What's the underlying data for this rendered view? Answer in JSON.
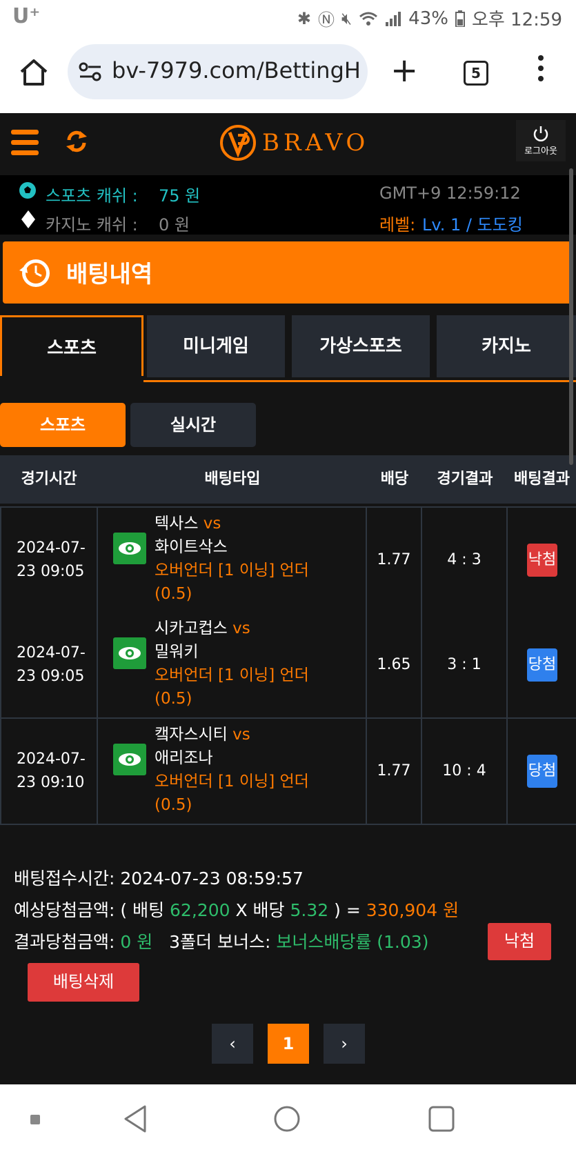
{
  "status_bar": {
    "carrier": "U⁺",
    "battery": "43%",
    "time": "오후 12:59"
  },
  "browser": {
    "url": "bv-7979.com/BettingH",
    "tab_count": "5"
  },
  "site": {
    "logo_text": "BRAVO",
    "logout_label": "로그아웃"
  },
  "account": {
    "sports_cash_label": "스포츠 캐쉬 :",
    "sports_cash_value": "75 원",
    "casino_cash_label": "카지노 캐쉬 :",
    "casino_cash_value": "0 원",
    "clock": "GMT+9 12:59:12",
    "level_label": "레벨:",
    "level_value": "Lv. 1 / 도도킹"
  },
  "page_title": "배팅내역",
  "main_tabs": [
    "스포츠",
    "미니게임",
    "가상스포츠",
    "카지노"
  ],
  "sub_tabs": [
    "스포츠",
    "실시간"
  ],
  "table": {
    "headers": [
      "경기시간",
      "배팅타입",
      "배당",
      "경기결과",
      "배팅결과"
    ],
    "rows": [
      {
        "date": "2024-07-",
        "time": "23 09:05",
        "home": "텍사스",
        "vs": "vs",
        "away": "화이트삭스",
        "bet1": "오버언더 [1 이닝] 언더",
        "bet2": "(0.5)",
        "odds": "1.77",
        "score": "4 : 3",
        "result": "낙첨"
      },
      {
        "date": "2024-07-",
        "time": "23 09:05",
        "home": "시카고컵스",
        "vs": "vs",
        "away": "밀워키",
        "bet1": "오버언더 [1 이닝] 언더",
        "bet2": "(0.5)",
        "odds": "1.65",
        "score": "3 : 1",
        "result": "당첨"
      },
      {
        "date": "2024-07-",
        "time": "23 09:10",
        "home": "캨자스시티",
        "vs": "vs",
        "away": "애리조나",
        "bet1": "오버언더 [1 이닝] 언더",
        "bet2": "(0.5)",
        "odds": "1.77",
        "score": "10 : 4",
        "result": "당첨"
      }
    ]
  },
  "summary": {
    "receipt_label": "배팅접수시간:",
    "receipt_value": "2024-07-23 08:59:57",
    "expected_label": "예상당첨금액: ( 배팅",
    "bet_amount": "62,200",
    "x_odds_label": "X 배당",
    "total_odds": "5.32",
    "equals": ") =",
    "expected_payout": "330,904 원",
    "result_label": "결과당첨금액:",
    "result_value": "0 원",
    "bonus_label": "3폴더 보너스:",
    "bonus_value": "보너스배당률 (1.03)",
    "status_badge": "낙첨",
    "delete_button": "배팅삭제"
  },
  "pagination": {
    "prev": "‹",
    "current": "1",
    "next": "›"
  },
  "colors": {
    "accent": "#ff7a00",
    "lose": "#dd3a3a",
    "win": "#2f80ed",
    "eye": "#1f9d3a"
  }
}
